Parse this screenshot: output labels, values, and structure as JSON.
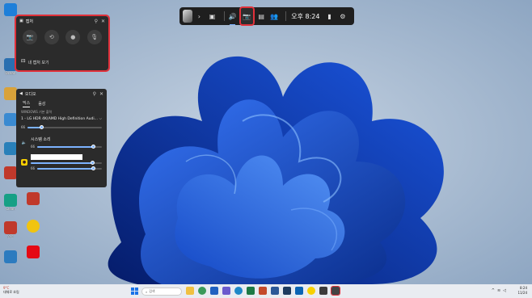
{
  "colors": {
    "highlight": "#e0303a",
    "accent": "#7cb2ff",
    "panel": "#2b2b2b",
    "gamebar": "#1f1f1f",
    "taskbar": "#e9ecf1"
  },
  "desktop": {
    "left_column": [
      {
        "label": "",
        "color": "#1e7fd9"
      },
      {
        "label": "Ocean",
        "color": "#2a6fb0"
      },
      {
        "label": "",
        "color": "#d9a23a"
      },
      {
        "label": "",
        "color": "#3a8ad1"
      },
      {
        "label": "",
        "color": "#c0392b"
      },
      {
        "label": "",
        "color": "#2980b9"
      },
      {
        "label": "",
        "color": "#e67e22"
      },
      {
        "label": "Clean",
        "color": "#16a085"
      },
      {
        "label": "안전",
        "color": "#c0392b"
      },
      {
        "label": "",
        "color": "#2c7bbf"
      }
    ],
    "second_column": [
      {
        "label": "",
        "color": "#c0392b"
      },
      {
        "label": "",
        "color": "#f1c40f"
      },
      {
        "label": "",
        "color": "#e50914"
      }
    ]
  },
  "gamebar": {
    "time": "오후 8:24",
    "chevron": "›",
    "buttons": [
      "widget-menu",
      "audio",
      "capture",
      "performance",
      "social",
      "battery",
      "settings"
    ],
    "icons": {
      "widget": "▣",
      "audio": "🔊",
      "capture": "📷",
      "perf": "▤",
      "social": "👥",
      "battery": "▮",
      "settings": "⚙"
    }
  },
  "capture": {
    "title": "캡처",
    "pin": "⚲",
    "close": "✕",
    "button_icons": [
      "📷",
      "⟲",
      "●",
      "🎙"
    ],
    "see_all": "내 캡처 보기",
    "gallery_icon": "🖾"
  },
  "audio": {
    "title": "오디오",
    "pin": "⚲",
    "close": "✕",
    "tabs": [
      {
        "label": "믹스",
        "active": true
      },
      {
        "label": "음성",
        "active": false
      }
    ],
    "default_output_label": "WINDOWS 기본 출력",
    "device": "1 - LG HDR 4K(AMD High Definition Audi...",
    "device_chevron": "⌵",
    "device_volume": {
      "label": "66",
      "level": 0.18
    },
    "system_sound": {
      "label": "시스템 소리",
      "vol_label": "66",
      "level": 0.86
    },
    "app2": {
      "vol_label": "",
      "level": 0.86
    },
    "app3": {
      "vol_label": "66",
      "level": 0.86
    }
  },
  "taskbar": {
    "weather_temp": "9°C",
    "weather_desc": "대체로 흐림",
    "search": "검색",
    "time": "8:24",
    "date": "11/24",
    "apps": [
      {
        "name": "files",
        "color": "#f0c040"
      },
      {
        "name": "chrome",
        "color": "#3a9a5a"
      },
      {
        "name": "store",
        "color": "#2060c0"
      },
      {
        "name": "teams",
        "color": "#6a5acd"
      },
      {
        "name": "edge",
        "color": "#1e88c8"
      },
      {
        "name": "excel",
        "color": "#1d7a45"
      },
      {
        "name": "powerpoint",
        "color": "#c44a2a"
      },
      {
        "name": "word",
        "color": "#2b5797"
      },
      {
        "name": "photoshop",
        "color": "#1c3a5e"
      },
      {
        "name": "outlook",
        "color": "#0a64b4"
      },
      {
        "name": "kakaotalk",
        "color": "#f7d000"
      },
      {
        "name": "app",
        "color": "#3b3b3b"
      },
      {
        "name": "gamebar",
        "color": "#444444"
      }
    ]
  }
}
